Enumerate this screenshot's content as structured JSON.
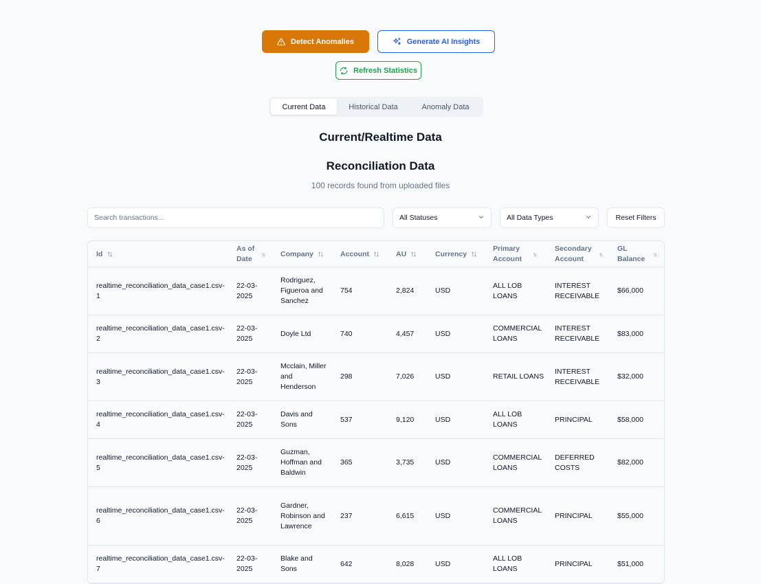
{
  "actions": {
    "detect_label": "Detect Anomalies",
    "ai_label": "Generate AI Insights",
    "refresh_label": "Refresh Statistics"
  },
  "tabs": [
    {
      "label": "Current Data",
      "active": true
    },
    {
      "label": "Historical Data",
      "active": false
    },
    {
      "label": "Anomaly Data",
      "active": false
    }
  ],
  "section_title": "Current/Realtime Data",
  "reconciliation": {
    "title": "Reconciliation Data",
    "subtitle": "100 records found from uploaded files"
  },
  "filters": {
    "search_placeholder": "Search transactions...",
    "status_value": "All Statuses",
    "type_value": "All Data Types",
    "reset_label": "Reset Filters"
  },
  "table": {
    "columns": [
      "Id",
      "As of Date",
      "Company",
      "Account",
      "AU",
      "Currency",
      "Primary Account",
      "Secondary Account",
      "GL Balance"
    ],
    "rows": [
      {
        "id": "realtime_reconciliation_data_case1.csv-1",
        "date": "22-03-2025",
        "company": "Rodriguez, Figueroa and Sanchez",
        "account": "754",
        "au": "2,824",
        "currency": "USD",
        "primary": "ALL LOB LOANS",
        "secondary": "INTEREST RECEIVABLE",
        "gl": "$66,000"
      },
      {
        "id": "realtime_reconciliation_data_case1.csv-2",
        "date": "22-03-2025",
        "company": "Doyle Ltd",
        "account": "740",
        "au": "4,457",
        "currency": "USD",
        "primary": "COMMERCIAL LOANS",
        "secondary": "INTEREST RECEIVABLE",
        "gl": "$83,000"
      },
      {
        "id": "realtime_reconciliation_data_case1.csv-3",
        "date": "22-03-2025",
        "company": "Mcclain, Miller and Henderson",
        "account": "298",
        "au": "7,026",
        "currency": "USD",
        "primary": "RETAIL LOANS",
        "secondary": "INTEREST RECEIVABLE",
        "gl": "$32,000"
      },
      {
        "id": "realtime_reconciliation_data_case1.csv-4",
        "date": "22-03-2025",
        "company": "Davis and Sons",
        "account": "537",
        "au": "9,120",
        "currency": "USD",
        "primary": "ALL LOB LOANS",
        "secondary": "PRINCIPAL",
        "gl": "$58,000"
      },
      {
        "id": "realtime_reconciliation_data_case1.csv-5",
        "date": "22-03-2025",
        "company": "Guzman, Hoffman and Baldwin",
        "account": "365",
        "au": "3,735",
        "currency": "USD",
        "primary": "COMMERCIAL LOANS",
        "secondary": "DEFERRED COSTS",
        "gl": "$82,000"
      },
      {
        "id": "realtime_reconciliation_data_case1.csv-6",
        "date": "22-03-2025",
        "company": "Gardner, Robinson and Lawrence",
        "account": "237",
        "au": "6,615",
        "currency": "USD",
        "primary": "COMMERCIAL LOANS",
        "secondary": "PRINCIPAL",
        "gl": "$55,000"
      },
      {
        "id": "realtime_reconciliation_data_case1.csv-7",
        "date": "22-03-2025",
        "company": "Blake and Sons",
        "account": "642",
        "au": "8,028",
        "currency": "USD",
        "primary": "ALL LOB LOANS",
        "secondary": "PRINCIPAL",
        "gl": "$51,000"
      }
    ]
  },
  "colors": {
    "detect": "#d97706",
    "ai": "#2563eb",
    "refresh": "#16a34a"
  }
}
